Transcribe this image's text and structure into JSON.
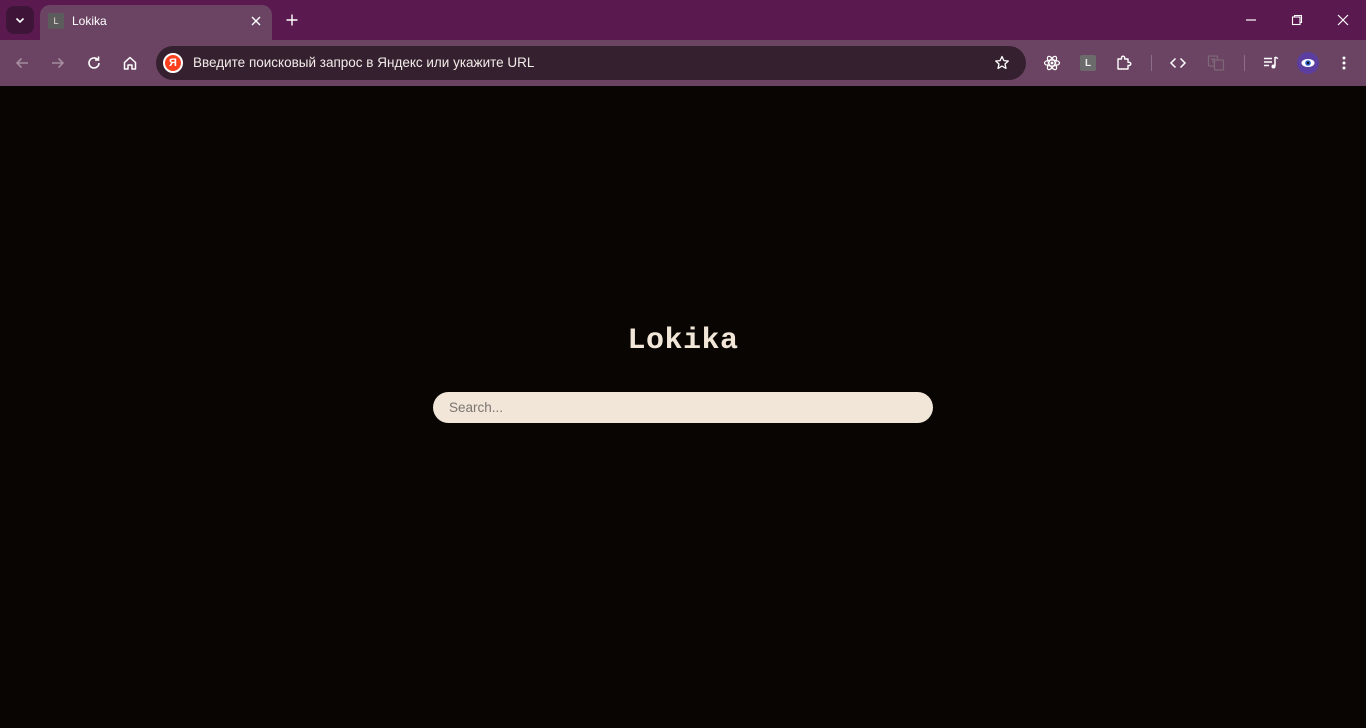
{
  "browser": {
    "tab": {
      "title": "Lokika",
      "favicon_letter": "L"
    },
    "omnibox": {
      "text": "Введите поисковый запрос в Яндекс или укажите URL",
      "logo_letter": "Я"
    },
    "extension_letter": "L",
    "icons": [
      "tab-list-icon",
      "close-icon",
      "plus-icon",
      "minimize-icon",
      "restore-icon",
      "back-icon",
      "forward-icon",
      "reload-icon",
      "home-icon",
      "star-icon",
      "react-icon",
      "puzzle-icon",
      "code-icon",
      "translate-icon",
      "media-icon",
      "menu-icon"
    ]
  },
  "colors": {
    "tabstrip": "#5a1a50",
    "toolbar": "#6a4462",
    "omnibox": "#35202f",
    "page_bg": "#080502",
    "accent_cream": "#f2e6d8"
  },
  "page": {
    "title": "Lokika",
    "search": {
      "placeholder": "Search...",
      "value": ""
    }
  }
}
